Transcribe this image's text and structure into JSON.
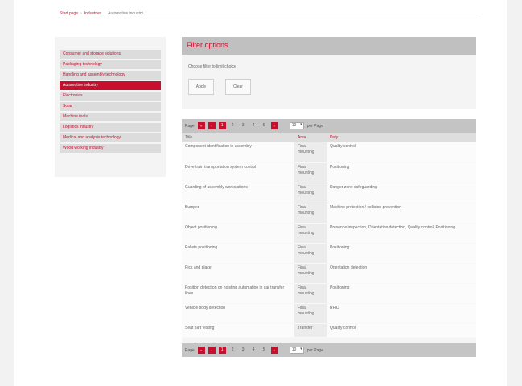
{
  "breadcrumb": {
    "items": [
      "Start page",
      "Industries",
      "Automotive industry"
    ]
  },
  "sidebar": {
    "items": [
      {
        "label": "Consumer and storage solutions"
      },
      {
        "label": "Packaging technology"
      },
      {
        "label": "Handling and assembly technology"
      },
      {
        "label": "Automotive industry"
      },
      {
        "label": "Electronics"
      },
      {
        "label": "Solar"
      },
      {
        "label": "Machine tools"
      },
      {
        "label": "Logistics industry"
      },
      {
        "label": "Medical and analysis technology"
      },
      {
        "label": "Wood working industry"
      }
    ]
  },
  "filter": {
    "title": "Filter options",
    "instruction": "Choose filter to limit choice",
    "apply_label": "Apply",
    "clear_label": "Clear"
  },
  "pager": {
    "page_label": "Page",
    "first": "«",
    "prev": "‹",
    "next": "›",
    "pages": [
      "1",
      "2",
      "3",
      "4",
      "5"
    ],
    "per_page_value": "10",
    "per_page_label": "per Page"
  },
  "table": {
    "headers": [
      "Title",
      "Area",
      "Duty"
    ],
    "rows": [
      [
        "Component identification in assembly",
        "Final mounting",
        "Quality control"
      ],
      [
        "Drive train transportation system control",
        "Final mounting",
        "Positioning"
      ],
      [
        "Guarding of assembly workstations",
        "Final mounting",
        "Danger zone safeguarding"
      ],
      [
        "Bumper",
        "Final mounting",
        "Machine protection / collision prevention"
      ],
      [
        "Object positioning",
        "Final mounting",
        "Presence inspection, Orientation detection, Quality control, Positioning"
      ],
      [
        "Pallets positioning",
        "Final mounting",
        "Positioning"
      ],
      [
        "Pick and place",
        "Final mounting",
        "Orientation detection"
      ],
      [
        "Position detection on hoisting automation in car transfer lines",
        "Final mounting",
        "Positioning"
      ],
      [
        "Vehicle body detection",
        "Final mounting",
        "RFID"
      ],
      [
        "Seat part testing",
        "Transfer",
        "Quality control"
      ]
    ]
  }
}
